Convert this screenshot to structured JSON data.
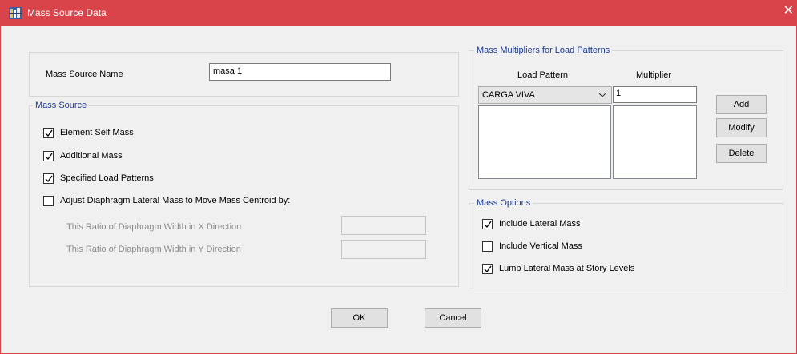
{
  "window": {
    "title": "Mass Source Data",
    "close_glyph": "✕"
  },
  "name_field": {
    "label": "Mass Source Name",
    "value": "masa 1"
  },
  "mass_source": {
    "legend": "Mass Source",
    "element_self_mass": {
      "label": "Element Self Mass",
      "checked": true
    },
    "additional_mass": {
      "label": "Additional Mass",
      "checked": true
    },
    "specified_load_patterns": {
      "label": "Specified Load Patterns",
      "checked": true
    },
    "adjust_diaphragm": {
      "label": "Adjust Diaphragm Lateral Mass to Move Mass Centroid by:",
      "checked": false
    },
    "ratio_x_label": "This Ratio of Diaphragm Width in X Direction",
    "ratio_x_value": "",
    "ratio_y_label": "This Ratio of Diaphragm Width in Y Direction",
    "ratio_y_value": ""
  },
  "multipliers": {
    "legend": "Mass Multipliers for Load Patterns",
    "col_load_pattern": "Load Pattern",
    "col_multiplier": "Multiplier",
    "selected_pattern": "CARGA VIVA",
    "multiplier_value": "1",
    "add_label": "Add",
    "modify_label": "Modify",
    "delete_label": "Delete"
  },
  "mass_options": {
    "legend": "Mass Options",
    "include_lateral": {
      "label": "Include Lateral Mass",
      "checked": true
    },
    "include_vertical": {
      "label": "Include Vertical Mass",
      "checked": false
    },
    "lump_lateral": {
      "label": "Lump Lateral Mass at Story Levels",
      "checked": true
    }
  },
  "footer": {
    "ok_label": "OK",
    "cancel_label": "Cancel"
  },
  "colors": {
    "titlebar": "#d9434a",
    "legend": "#1c3b8f",
    "disabled_text": "#8b8b8b"
  }
}
